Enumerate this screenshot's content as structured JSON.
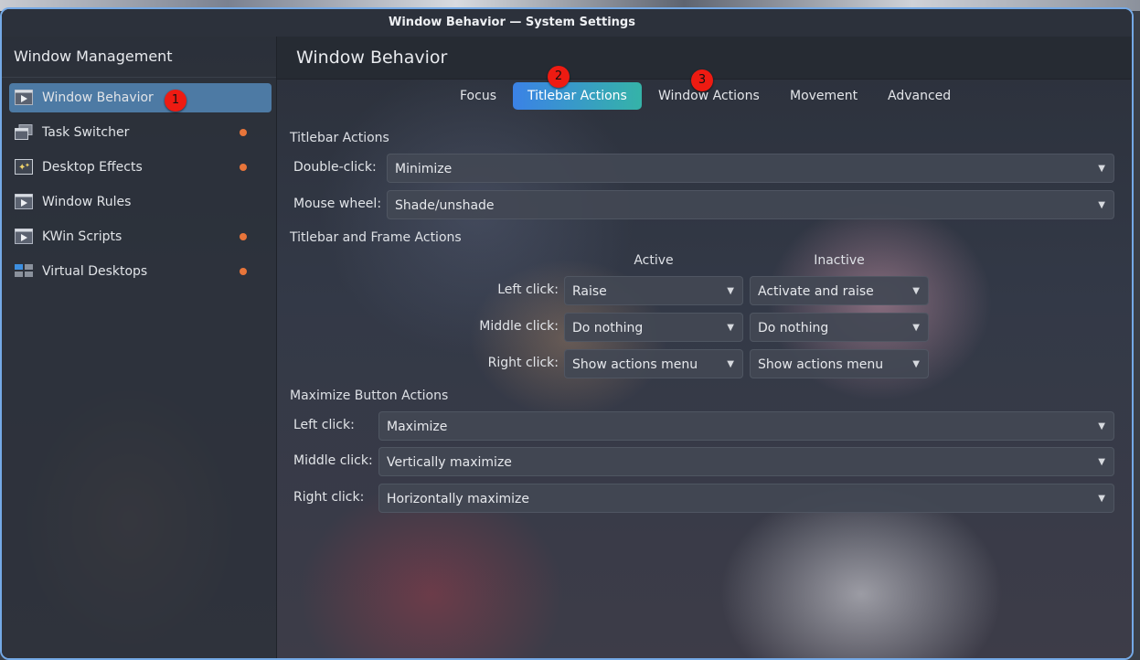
{
  "window": {
    "title": "Window Behavior — System Settings"
  },
  "sidebar": {
    "header": "Window Management",
    "items": [
      {
        "label": "Window Behavior",
        "icon": "window-behavior-icon",
        "modified": false,
        "active": true
      },
      {
        "label": "Task Switcher",
        "icon": "task-switcher-icon",
        "modified": true
      },
      {
        "label": "Desktop Effects",
        "icon": "desktop-effects-icon",
        "modified": true
      },
      {
        "label": "Window Rules",
        "icon": "window-rules-icon",
        "modified": false
      },
      {
        "label": "KWin Scripts",
        "icon": "kwin-scripts-icon",
        "modified": true
      },
      {
        "label": "Virtual Desktops",
        "icon": "virtual-desktops-icon",
        "modified": true
      }
    ]
  },
  "page": {
    "title": "Window Behavior"
  },
  "tabs": [
    {
      "label": "Focus"
    },
    {
      "label": "Titlebar Actions",
      "active": true
    },
    {
      "label": "Window Actions"
    },
    {
      "label": "Movement"
    },
    {
      "label": "Advanced"
    }
  ],
  "titlebar_actions": {
    "section": "Titlebar Actions",
    "double_click": {
      "label": "Double-click:",
      "value": "Minimize"
    },
    "mouse_wheel": {
      "label": "Mouse wheel:",
      "value": "Shade/unshade"
    }
  },
  "frame_actions": {
    "section": "Titlebar and Frame Actions",
    "col_active": "Active",
    "col_inactive": "Inactive",
    "rows": [
      {
        "label": "Left click:",
        "active": "Raise",
        "inactive": "Activate and raise"
      },
      {
        "label": "Middle click:",
        "active": "Do nothing",
        "inactive": "Do nothing"
      },
      {
        "label": "Right click:",
        "active": "Show actions menu",
        "inactive": "Show actions menu"
      }
    ]
  },
  "maximize_actions": {
    "section": "Maximize Button Actions",
    "rows": [
      {
        "label": "Left click:",
        "value": "Maximize"
      },
      {
        "label": "Middle click:",
        "value": "Vertically maximize"
      },
      {
        "label": "Right click:",
        "value": "Horizontally maximize"
      }
    ]
  },
  "badges": [
    "1",
    "2",
    "3"
  ],
  "colors": {
    "accent": "#4d7aa4",
    "modified_dot": "#e8753a",
    "badge": "#ee1b12",
    "window_border": "#74a9e6"
  }
}
